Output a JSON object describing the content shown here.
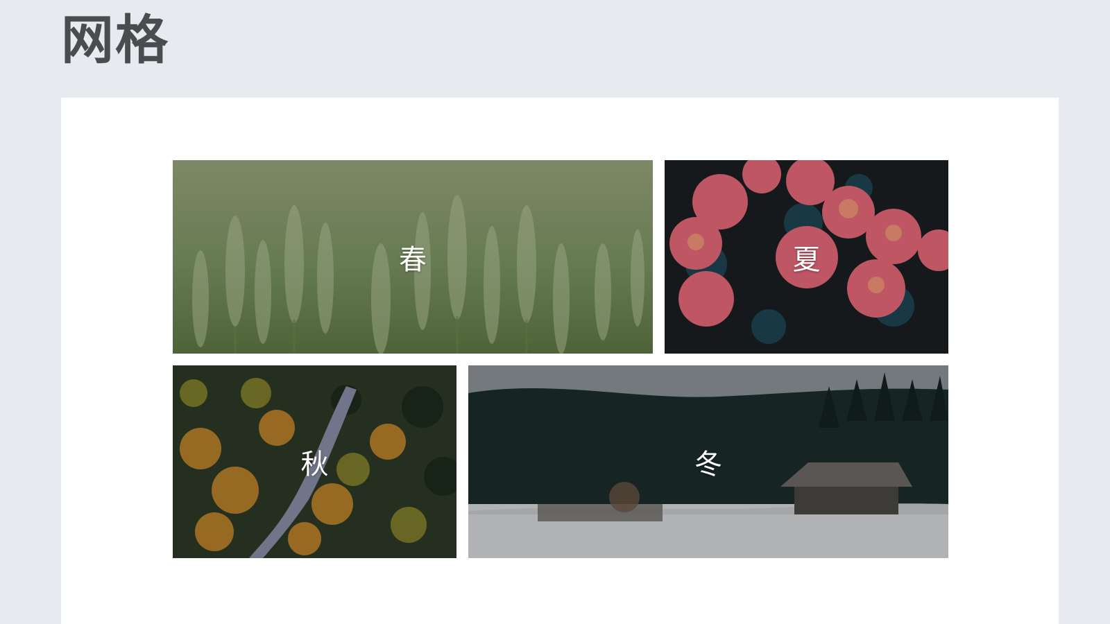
{
  "page": {
    "title": "网格"
  },
  "grid": {
    "tiles": [
      {
        "id": "spring",
        "label": "春",
        "scene": "wheat-field"
      },
      {
        "id": "summer",
        "label": "夏",
        "scene": "pink-roses"
      },
      {
        "id": "autumn",
        "label": "秋",
        "scene": "autumn-forest-road"
      },
      {
        "id": "winter",
        "label": "冬",
        "scene": "snowy-cabin-forest"
      }
    ]
  },
  "colors": {
    "background": "#e7ebf0",
    "panel": "#ffffff",
    "title": "#4a4d50",
    "caption": "#ffffff"
  }
}
